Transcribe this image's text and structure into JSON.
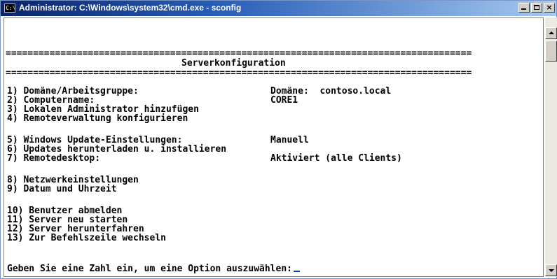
{
  "window": {
    "title": "Administrator: C:\\Windows\\system32\\cmd.exe - sconfig",
    "icon_text": "C:\\",
    "controls": {
      "minimize": "minimize-icon",
      "maximize": "maximize-icon",
      "close": "×"
    }
  },
  "console": {
    "separator": "=====================================================================================",
    "heading": "Serverkonfiguration",
    "options": [
      {
        "label": "1) Domäne/Arbeitsgruppe:",
        "value": "Domäne:  contoso.local"
      },
      {
        "label": "2) Computername:",
        "value": "CORE1"
      },
      {
        "label": "3) Lokalen Administrator hinzufügen",
        "value": ""
      },
      {
        "label": "4) Remoteverwaltung konfigurieren",
        "value": ""
      },
      {
        "label": "5) Windows Update-Einstellungen:",
        "value": "Manuell"
      },
      {
        "label": "6) Updates herunterladen u. installieren",
        "value": ""
      },
      {
        "label": "7) Remotedesktop:",
        "value": "Aktiviert (alle Clients)"
      },
      {
        "label": "8) Netzwerkeinstellungen",
        "value": ""
      },
      {
        "label": "9) Datum und Uhrzeit",
        "value": ""
      },
      {
        "label": "10) Benutzer abmelden",
        "value": ""
      },
      {
        "label": "11) Server neu starten",
        "value": ""
      },
      {
        "label": "12) Server herunterfahren",
        "value": ""
      },
      {
        "label": "13) Zur Befehlszeile wechseln",
        "value": ""
      }
    ],
    "prompt": "Geben Sie eine Zahl ein, um eine Option auszuwählen:"
  }
}
